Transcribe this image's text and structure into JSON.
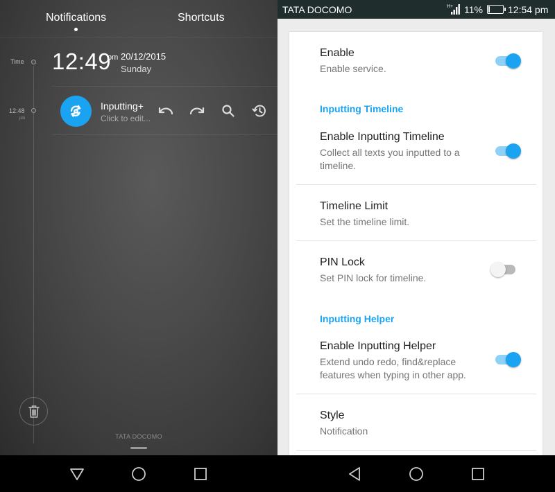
{
  "left": {
    "tabs": {
      "notifications": "Notifications",
      "shortcuts": "Shortcuts"
    },
    "timeline": {
      "time_label": "Time",
      "entry_time": "12:48",
      "entry_ampm": "pm"
    },
    "clock": {
      "time": "12:49",
      "ampm": "pm",
      "date": "20/12/2015",
      "day": "Sunday"
    },
    "notification": {
      "title": "Inputting+",
      "subtitle": "Click to edit..."
    },
    "carrier": "TATA DOCOMO"
  },
  "statusbar": {
    "carrier": "TATA DOCOMO",
    "network": "H+",
    "battery_pct": "11%",
    "battery_level": 0.11,
    "time": "12:54 pm"
  },
  "settings": {
    "enable": {
      "title": "Enable",
      "summary": "Enable service.",
      "on": true
    },
    "cat_timeline": "Inputting Timeline",
    "enable_timeline": {
      "title": "Enable Inputting Timeline",
      "summary_1": "Collect all texts you inputted to a",
      "summary_2": "timeline.",
      "on": true
    },
    "timeline_limit": {
      "title": "Timeline Limit",
      "summary": "Set the timeline limit."
    },
    "pin_lock": {
      "title": "PIN Lock",
      "summary": "Set PIN lock for timeline.",
      "on": false
    },
    "cat_helper": "Inputting Helper",
    "enable_helper": {
      "title": "Enable Inputting Helper",
      "summary_1": "Extend undo redo, find&replace",
      "summary_2": "features when typing in other app.",
      "on": true
    },
    "style": {
      "title": "Style",
      "summary": "Notification"
    }
  },
  "colors": {
    "accent": "#1aa3f0",
    "statusbar": "#1f2e2c"
  },
  "icons": [
    "undo-icon",
    "redo-icon",
    "search-icon",
    "history-icon",
    "trash-icon",
    "back-icon",
    "home-icon",
    "recents-icon",
    "signal-icon",
    "battery-icon"
  ]
}
